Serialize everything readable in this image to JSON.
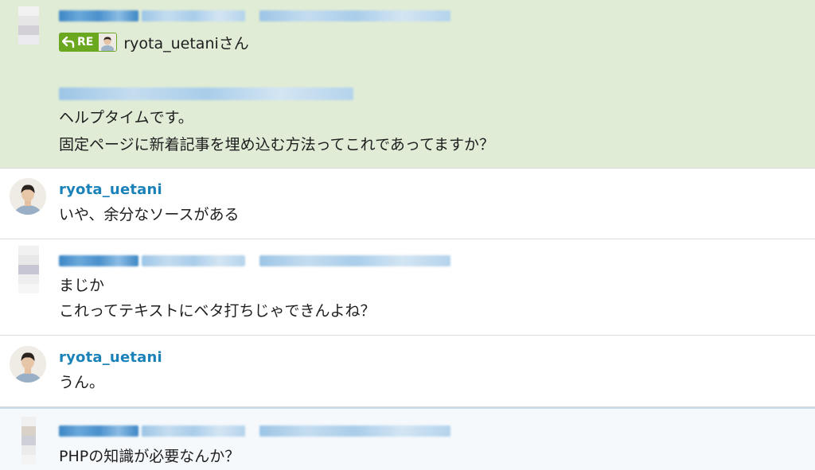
{
  "messages": [
    {
      "reply_to_badge": "RE",
      "reply_to_name": "ryota_uetaniさん",
      "lines": [
        "ヘルプタイムです。",
        "固定ページに新着記事を埋め込む方法ってこれであってますか？"
      ]
    },
    {
      "username": "ryota_uetani",
      "lines": [
        "いや、余分なソースがある"
      ]
    },
    {
      "lines": [
        "まじか",
        "これってテキストにベタ打ちじゃできんよね？"
      ]
    },
    {
      "username": "ryota_uetani",
      "lines": [
        "うん。"
      ]
    },
    {
      "lines": [
        "PHPの知識が必要なんか？"
      ]
    }
  ],
  "colors": {
    "highlight_bg": "#e0ecd6",
    "username": "#1a82b8",
    "re_badge": "#6aa820"
  },
  "icons": {
    "reply": "reply-arrow-icon"
  }
}
